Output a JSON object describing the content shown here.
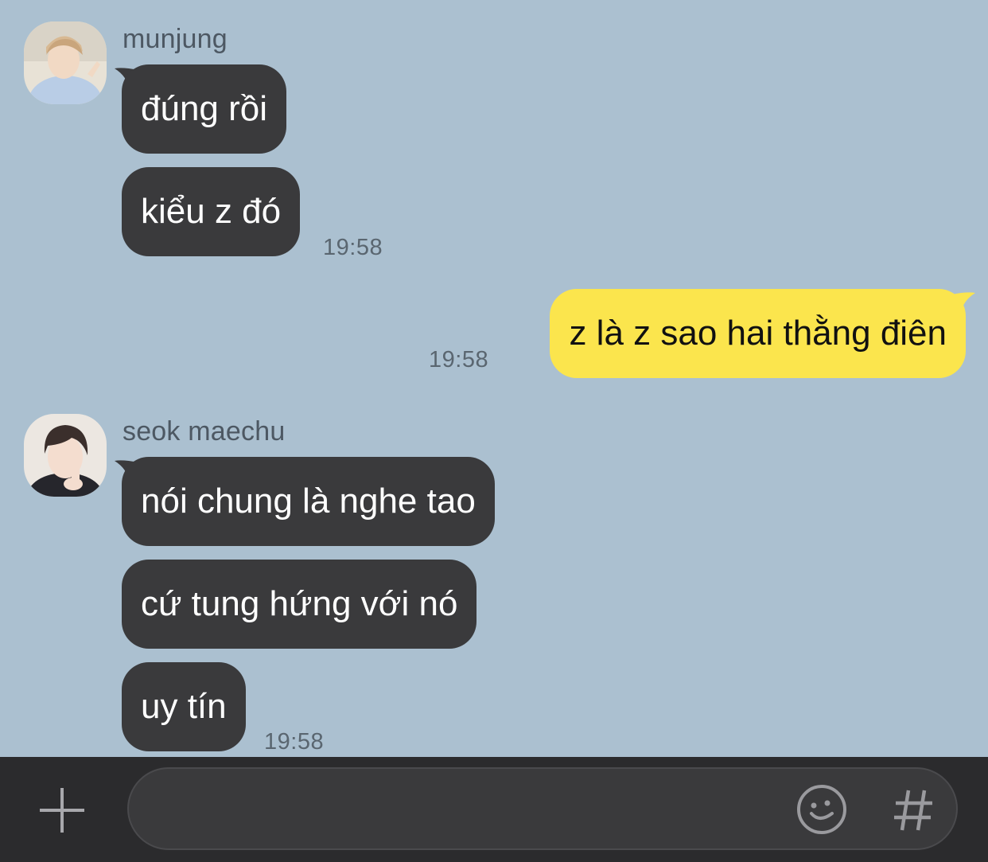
{
  "chat": {
    "groups": [
      {
        "sender": "munjung",
        "messages": [
          "đúng rồi",
          "kiểu z đó"
        ],
        "time": "19:58"
      },
      {
        "mine": true,
        "messages": [
          "z là z sao hai thằng điên"
        ],
        "time": "19:58"
      },
      {
        "sender": "seok maechu",
        "messages": [
          "nói chung là nghe tao",
          "cứ tung hứng với nó",
          "uy tín"
        ],
        "time": "19:58"
      }
    ]
  },
  "input_bar": {
    "text_value": "",
    "icons": {
      "add": "plus-icon",
      "emoji": "smiley-icon",
      "hashtag": "hash-icon"
    }
  },
  "colors": {
    "chat_background": "#abc0d0",
    "incoming_bubble": "#3a3a3c",
    "outgoing_bubble": "#fbe54d",
    "input_bar": "#2b2b2d"
  }
}
